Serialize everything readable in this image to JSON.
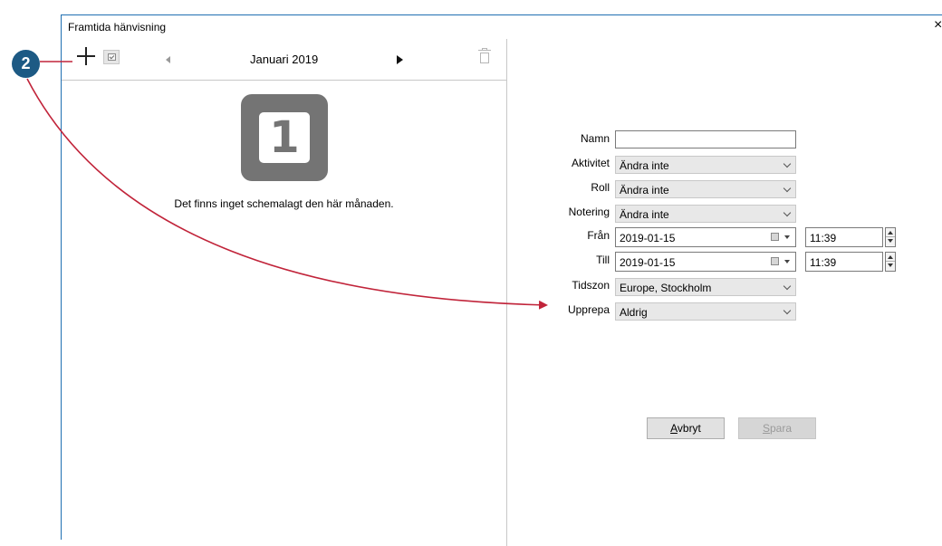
{
  "window": {
    "title": "Framtida hänvisning",
    "close_glyph": "×"
  },
  "toolbar": {
    "add_icon": "plus-icon",
    "check_icon": "checkbox-icon",
    "prev_icon": "triangle-left-icon",
    "next_icon": "triangle-right-icon",
    "delete_icon": "trash-icon",
    "month_label": "Januari 2019"
  },
  "calendar": {
    "icon": "calendar-icon",
    "day_number": "1",
    "empty_message": "Det finns inget schemalagt den här månaden."
  },
  "form": {
    "name": {
      "label": "Namn",
      "value": ""
    },
    "activity": {
      "label": "Aktivitet",
      "value": "Ändra inte"
    },
    "role": {
      "label": "Roll",
      "value": "Ändra inte"
    },
    "note": {
      "label": "Notering",
      "value": "Ändra inte"
    },
    "from": {
      "label": "Från",
      "date": "2019-01-15",
      "time": "11:39"
    },
    "to": {
      "label": "Till",
      "date": "2019-01-15",
      "time": "11:39"
    },
    "timezone": {
      "label": "Tidszon",
      "value": "Europe, Stockholm"
    },
    "repeat": {
      "label": "Upprepa",
      "value": "Aldrig"
    }
  },
  "buttons": {
    "cancel_mnemonic": "A",
    "cancel_rest": "vbryt",
    "save_mnemonic": "S",
    "save_rest": "para"
  },
  "annotation": {
    "badge_number": "2",
    "color": "#c1243a",
    "badge_color": "#1d5a84"
  }
}
